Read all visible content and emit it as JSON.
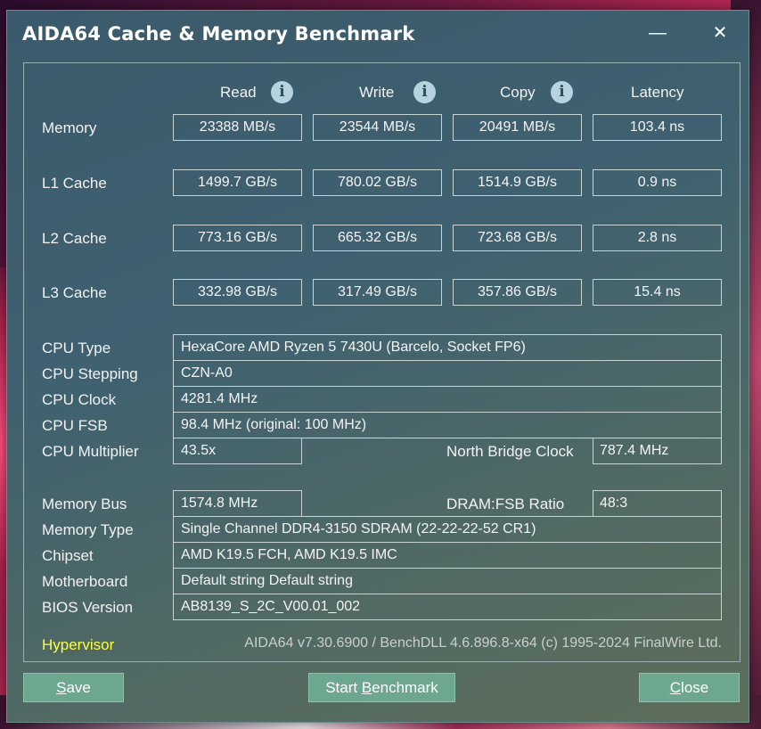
{
  "window": {
    "title": "AIDA64 Cache & Memory Benchmark",
    "minimize_glyph": "—",
    "close_glyph": "✕"
  },
  "columns": {
    "read": "Read",
    "write": "Write",
    "copy": "Copy",
    "latency": "Latency",
    "info_glyph": "i"
  },
  "bench_rows": [
    {
      "label": "Memory",
      "read": "23388 MB/s",
      "write": "23544 MB/s",
      "copy": "20491 MB/s",
      "latency": "103.4 ns"
    },
    {
      "label": "L1 Cache",
      "read": "1499.7 GB/s",
      "write": "780.02 GB/s",
      "copy": "1514.9 GB/s",
      "latency": "0.9 ns"
    },
    {
      "label": "L2 Cache",
      "read": "773.16 GB/s",
      "write": "665.32 GB/s",
      "copy": "723.68 GB/s",
      "latency": "2.8 ns"
    },
    {
      "label": "L3 Cache",
      "read": "332.98 GB/s",
      "write": "317.49 GB/s",
      "copy": "357.86 GB/s",
      "latency": "15.4 ns"
    }
  ],
  "cpu": {
    "type_label": "CPU Type",
    "type_value": "HexaCore AMD Ryzen 5 7430U  (Barcelo, Socket FP6)",
    "stepping_label": "CPU Stepping",
    "stepping_value": "CZN-A0",
    "clock_label": "CPU Clock",
    "clock_value": "4281.4 MHz",
    "fsb_label": "CPU FSB",
    "fsb_value": "98.4 MHz  (original: 100 MHz)",
    "multiplier_label": "CPU Multiplier",
    "multiplier_value": "43.5x",
    "nb_clock_label": "North Bridge Clock",
    "nb_clock_value": "787.4 MHz"
  },
  "memory": {
    "bus_label": "Memory Bus",
    "bus_value": "1574.8 MHz",
    "ratio_label": "DRAM:FSB Ratio",
    "ratio_value": "48:3",
    "type_label": "Memory Type",
    "type_value": "Single Channel DDR4-3150 SDRAM  (22-22-22-52 CR1)",
    "chipset_label": "Chipset",
    "chipset_value": "AMD K19.5 FCH, AMD K19.5 IMC",
    "motherboard_label": "Motherboard",
    "motherboard_value": "Default string Default string",
    "bios_label": "BIOS Version",
    "bios_value": "AB8139_S_2C_V00.01_002"
  },
  "status": {
    "hypervisor": "Hypervisor",
    "footer": "AIDA64 v7.30.6900 / BenchDLL 4.6.896.8-x64  (c) 1995-2024 FinalWire Ltd."
  },
  "buttons": {
    "save_u": "S",
    "save_rest": "ave",
    "bench_pre": "Start ",
    "bench_u": "B",
    "bench_rest": "enchmark",
    "close_u": "C",
    "close_rest": "lose"
  }
}
